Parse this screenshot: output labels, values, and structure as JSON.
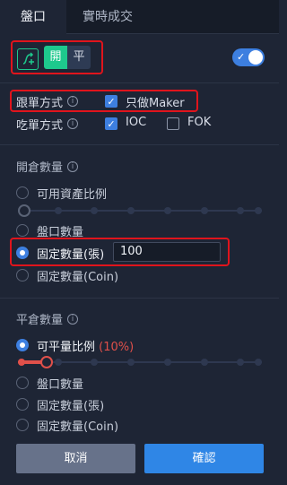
{
  "tabs": [
    {
      "label": "盤口",
      "active": true
    },
    {
      "label": "實時成交",
      "active": false
    }
  ],
  "mode": {
    "icon": "split-mode-icon",
    "open_label": "開",
    "close_label": "平",
    "switch_on": true
  },
  "order_options": {
    "follow_label": "跟單方式",
    "follow_option": "只做Maker",
    "follow_checked": true,
    "take_label": "吃單方式",
    "ioc_label": "IOC",
    "ioc_checked": true,
    "fok_label": "FOK",
    "fok_checked": false
  },
  "open_qty": {
    "title": "開倉數量",
    "options": [
      "可用資產比例",
      "盤口數量",
      "固定數量(張)",
      "固定數量(Coin)"
    ],
    "selected": "固定數量(張)",
    "fixed_value": "100",
    "slider_value": 0
  },
  "close_qty": {
    "title": "平倉數量",
    "ratio_label": "可平量比例",
    "ratio_value": "(10%)",
    "options": [
      "盤口數量",
      "固定數量(張)",
      "固定數量(Coin)"
    ],
    "slider_value": 0.1
  },
  "buttons": {
    "cancel": "取消",
    "confirm": "確認"
  },
  "colors": {
    "accent_blue": "#3d7fe0",
    "open_green": "#1ec98d",
    "slider_red": "#e0504a",
    "highlight_box": "#e0141c"
  }
}
